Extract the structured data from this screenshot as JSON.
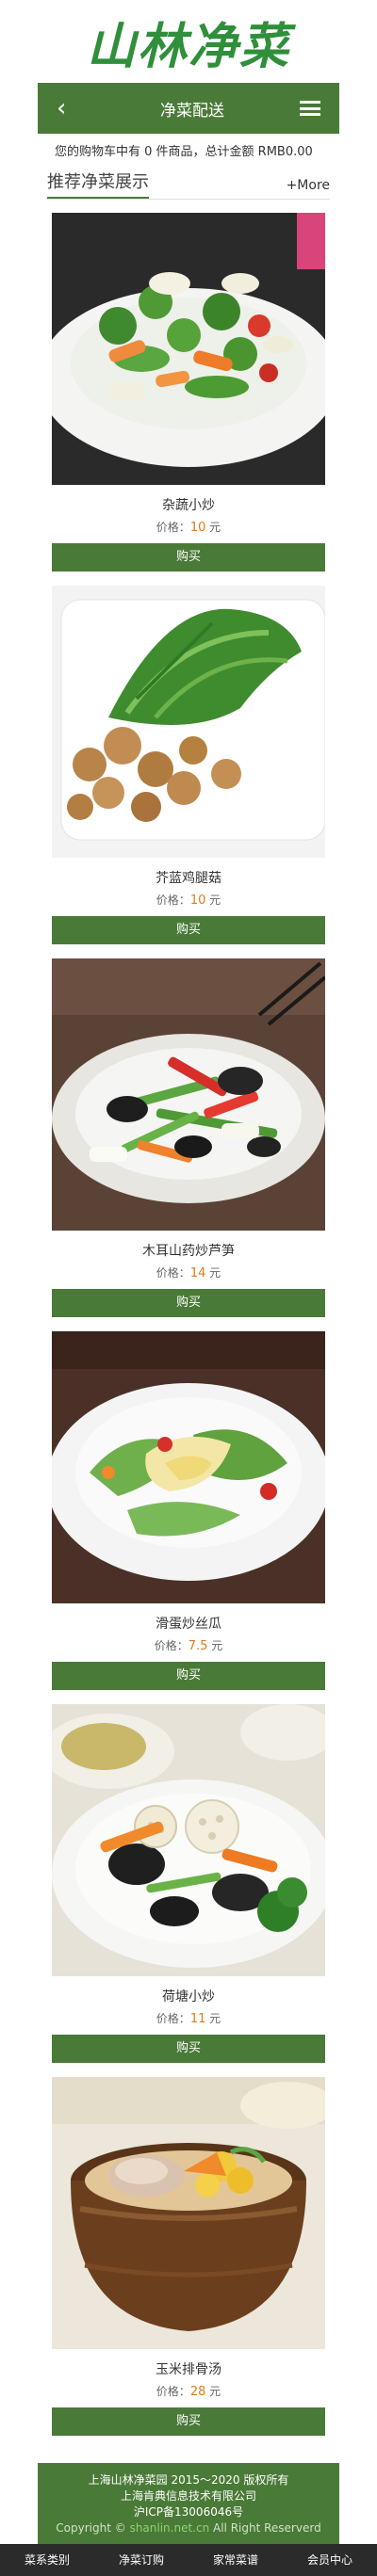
{
  "logo": {
    "text": "山林净菜"
  },
  "header": {
    "title": "净菜配送"
  },
  "cart": {
    "text": "您的购物车中有 0 件商品，总计金额 RMB0.00"
  },
  "section": {
    "title": "推荐净菜展示",
    "more": "+More"
  },
  "products": [
    {
      "name": "杂蔬小炒",
      "price_label": "价格：",
      "price": "10",
      "unit": " 元",
      "buy": "购买"
    },
    {
      "name": "芥蓝鸡腿菇",
      "price_label": "价格：",
      "price": "10",
      "unit": " 元",
      "buy": "购买"
    },
    {
      "name": "木耳山药炒芦笋",
      "price_label": "价格：",
      "price": "14",
      "unit": " 元",
      "buy": "购买"
    },
    {
      "name": "滑蛋炒丝瓜",
      "price_label": "价格：",
      "price": "7.5",
      "unit": " 元",
      "buy": "购买"
    },
    {
      "name": "荷塘小炒",
      "price_label": "价格：",
      "price": "11",
      "unit": " 元",
      "buy": "购买"
    },
    {
      "name": "玉米排骨汤",
      "price_label": "价格：",
      "price": "28",
      "unit": " 元",
      "buy": "购买"
    }
  ],
  "footer": {
    "line1": "上海山林净菜园 2015～2020 版权所有",
    "line2": "上海肯典信息技术有限公司",
    "line3": "沪ICP备13006046号",
    "copy_prefix": "Copyright © ",
    "copy_link": "shanlin.net.cn",
    "copy_suffix": " All Right Reserverd"
  },
  "bottom_nav": [
    "菜系类别",
    "净菜订购",
    "家常菜谱",
    "会员中心"
  ],
  "colors": {
    "accent": "#4a7a37",
    "price": "#e07a1a",
    "logo": "#2f8f3a",
    "nav_bg": "#2b2b2b"
  }
}
